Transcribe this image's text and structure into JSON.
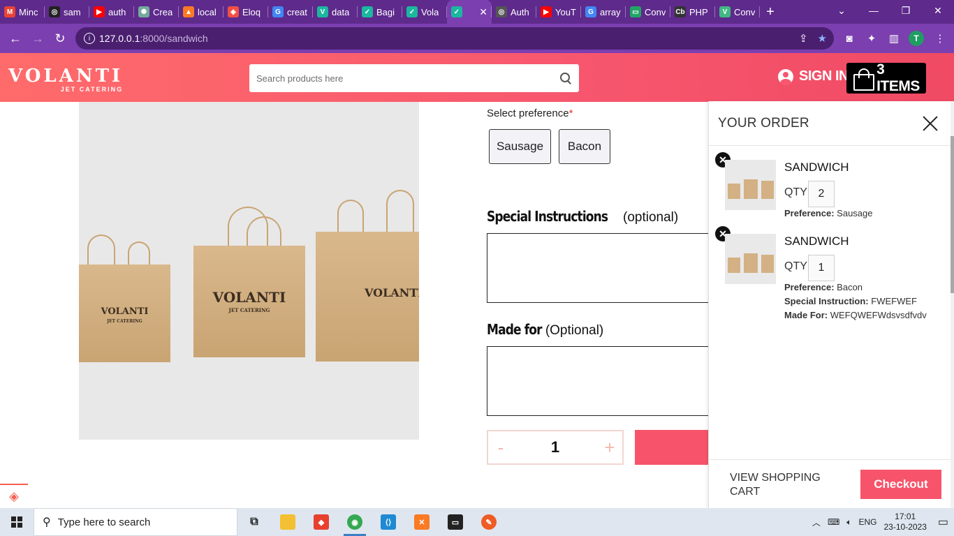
{
  "browser": {
    "tabs": [
      {
        "label": "Minc",
        "icon": "gmail-icon",
        "color": "#ea4335",
        "glyph": "M"
      },
      {
        "label": "sam",
        "icon": "github-icon",
        "color": "#222222",
        "glyph": "◎"
      },
      {
        "label": "auth",
        "icon": "youtube-icon",
        "color": "#ff0000",
        "glyph": "▶"
      },
      {
        "label": "Crea",
        "icon": "chatgpt-icon",
        "color": "#74aa9c",
        "glyph": "✺"
      },
      {
        "label": "local",
        "icon": "xampp-icon",
        "color": "#fb7a24",
        "glyph": "▲"
      },
      {
        "label": "Eloq",
        "icon": "laravel-icon",
        "color": "#f35045",
        "glyph": "◈"
      },
      {
        "label": "creat",
        "icon": "google-icon",
        "color": "#4285f4",
        "glyph": "G"
      },
      {
        "label": "data",
        "icon": "vuetify-icon",
        "color": "#1bb79e",
        "glyph": "V"
      },
      {
        "label": "Bagi",
        "icon": "vuetify-icon",
        "color": "#1bb79e",
        "glyph": "✓"
      },
      {
        "label": "Vola",
        "icon": "vuetify-icon",
        "color": "#1bb79e",
        "glyph": "✓"
      },
      {
        "label": "",
        "icon": "vuetify-icon",
        "color": "#1bb79e",
        "glyph": "✓"
      },
      {
        "label": "Auth",
        "icon": "github-icon",
        "color": "#555555",
        "glyph": "◎"
      },
      {
        "label": "YouT",
        "icon": "youtube-icon",
        "color": "#ff0000",
        "glyph": "▶"
      },
      {
        "label": "array",
        "icon": "google-icon",
        "color": "#4285f4",
        "glyph": "G"
      },
      {
        "label": "Conv",
        "icon": "sheet-icon",
        "color": "#22a565",
        "glyph": "▭"
      },
      {
        "label": "PHP",
        "icon": "codebeautify-icon",
        "color": "#333333",
        "glyph": "Cb"
      },
      {
        "label": "Conv",
        "icon": "vue-icon",
        "color": "#41b883",
        "glyph": "V"
      }
    ],
    "url_host": "127.0.0.1",
    "url_path": ":8000/sandwich",
    "profile_initial": "T"
  },
  "header": {
    "logo_main": "VOLANTI",
    "logo_sub": "JET CATERING",
    "search_placeholder": "Search products here",
    "signin_label": "SIGN IN",
    "cart_label": "3 ITEMS"
  },
  "product": {
    "bag_brand": "VOLANTI",
    "bag_sub": "JET CATERING",
    "preference_label": "Select preference",
    "preference_required": "*",
    "preferences": [
      "Sausage",
      "Bacon"
    ],
    "special_title": "Special Instructions",
    "special_optional": "(optional)",
    "madefor_title": "Made for",
    "madefor_optional": "(Optional)",
    "qty_minus": "-",
    "qty_value": "1",
    "qty_plus": "+"
  },
  "order": {
    "title": "YOUR ORDER",
    "items": [
      {
        "name": "SANDWICH",
        "qty_label": "QTY",
        "qty": "2",
        "pref_label": "Preference:",
        "pref": "Sausage"
      },
      {
        "name": "SANDWICH",
        "qty_label": "QTY",
        "qty": "1",
        "pref_label": "Preference:",
        "pref": "Bacon",
        "instr_label": "Special Instruction:",
        "instr": "FWEFWEF",
        "madefor_label": "Made For:",
        "madefor": "WEFQWEFWdsvsdfvdv"
      }
    ],
    "view_cart": "VIEW SHOPPING CART",
    "checkout": "Checkout"
  },
  "taskbar": {
    "search_placeholder": "Type here to search",
    "lang": "ENG",
    "time": "17:01",
    "date": "23-10-2023"
  },
  "colors": {
    "brand": "#f7546b",
    "browser_frame": "#7b3fb0"
  }
}
